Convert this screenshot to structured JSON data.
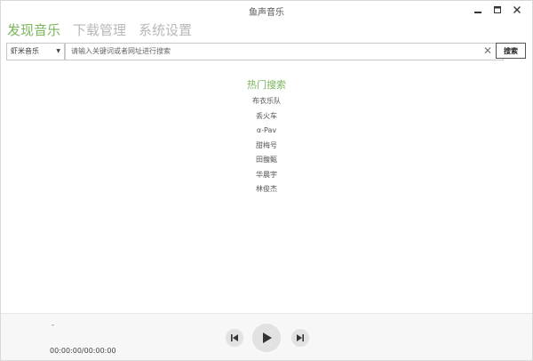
{
  "window": {
    "title": "鱼声音乐",
    "controls": {
      "minimize": "▬",
      "maximize": "□",
      "close": "✕"
    }
  },
  "tabs": [
    {
      "label": "发现音乐",
      "active": true
    },
    {
      "label": "下载管理",
      "active": false
    },
    {
      "label": "系统设置",
      "active": false
    }
  ],
  "search": {
    "source": "虾米音乐",
    "placeholder": "请输入关键词或者网址进行搜索",
    "value": "",
    "clear_icon": "✕",
    "button_label": "搜索"
  },
  "hot_search": {
    "title": "热门搜索",
    "items": [
      "布衣乐队",
      "丢火车",
      "α-Pav",
      "甜梅号",
      "田馥甄",
      "华晨宇",
      "林俊杰"
    ]
  },
  "player": {
    "track_name": "-",
    "time": "00:00:00/00:00:00"
  },
  "colors": {
    "accent": "#7ab55c",
    "inactive_tab": "#b8b8b8",
    "player_bg": "#f7f7f7",
    "control_bg": "#e2e2e2"
  },
  "icons": {
    "prev": "skip-previous-icon",
    "play": "play-icon",
    "next": "skip-next-icon",
    "dropdown": "caret-down-icon"
  }
}
